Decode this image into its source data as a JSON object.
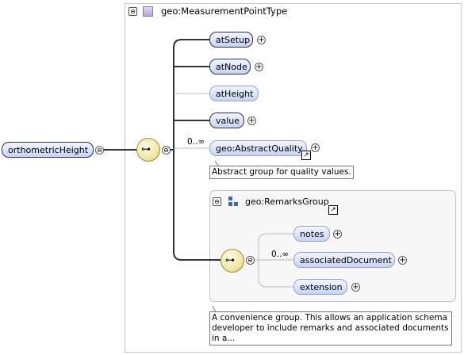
{
  "type_box": {
    "title": "geo:MeasurementPointType",
    "collapse_symbol": "⊖"
  },
  "root": {
    "label": "orthometricHeight",
    "collapse_symbol": "⊖"
  },
  "sequence_icon": "sequence-compositor-icon",
  "elements": [
    {
      "label": "atSetup",
      "expand_symbol": "+"
    },
    {
      "label": "atNode",
      "expand_symbol": "+"
    },
    {
      "label": "atHeight"
    },
    {
      "label": "value",
      "expand_symbol": "+"
    }
  ],
  "abstract_quality": {
    "cardinality": "0..∞",
    "label": "geo:AbstractQuality",
    "expand_symbol": "+",
    "annotation": "Abstract group for quality values."
  },
  "remarks_group": {
    "title": "geo:RemarksGroup",
    "collapse_symbol": "⊖",
    "cardinality": "0..∞",
    "children": [
      {
        "label": "notes",
        "expand_symbol": "+"
      },
      {
        "label": "associatedDocument",
        "expand_symbol": "+"
      },
      {
        "label": "extension",
        "expand_symbol": "+"
      }
    ],
    "annotation": "A convenience group. This allows an application schema developer to include remarks and associated documents in a..."
  },
  "colors": {
    "node_fill_top": "#f2f5ff",
    "node_fill_bottom": "#c5d4f5",
    "sequence_fill": "#f1e7a8",
    "group_box_border": "#bfc4cc"
  }
}
